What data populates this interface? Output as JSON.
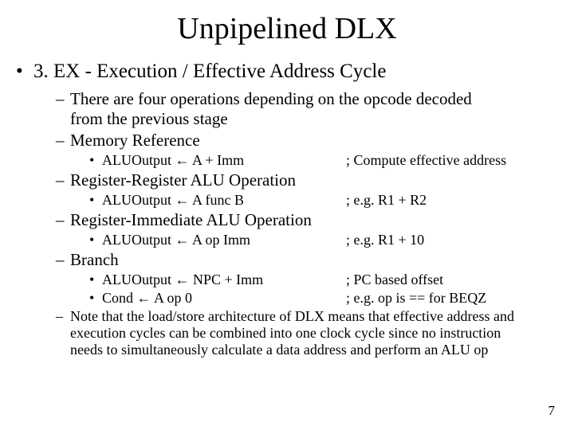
{
  "title": "Unpipelined DLX",
  "main": {
    "heading": "3. EX - Execution / Effective Address Cycle",
    "intro_l1": "There are four operations depending on the opcode decoded",
    "intro_l2": "from the previous stage",
    "sec1": "Memory Reference",
    "sec1_op": "ALUOutput ← A + Imm",
    "sec1_cm": "; Compute effective address",
    "sec2": "Register-Register ALU Operation",
    "sec2_op": "ALUOutput ← A func B",
    "sec2_cm": "; e.g. R1 + R2",
    "sec3": "Register-Immediate ALU Operation",
    "sec3_op": "ALUOutput ← A op Imm",
    "sec3_cm": "; e.g. R1 + 10",
    "sec4": "Branch",
    "sec4_op1": "ALUOutput ← NPC + Imm",
    "sec4_cm1": "; PC based offset",
    "sec4_op2": "Cond ← A op 0",
    "sec4_cm2": "; e.g. op is == for BEQZ",
    "note_l1": "Note that the load/store architecture of DLX means that effective address and",
    "note_l2": "execution cycles can be combined into one clock cycle since no instruction",
    "note_l3": "needs to simultaneously calculate a data address and perform an ALU op"
  },
  "page_number": "7"
}
